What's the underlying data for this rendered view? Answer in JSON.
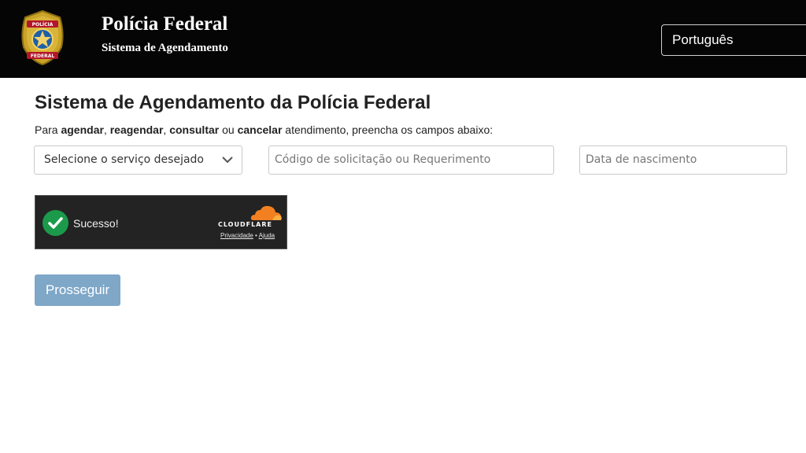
{
  "header": {
    "title": "Polícia Federal",
    "subtitle": "Sistema de Agendamento",
    "badge_text_top": "POLÍCIA",
    "badge_text_bottom": "FEDERAL",
    "language": "Português",
    "background": "#050505"
  },
  "main": {
    "title": "Sistema de Agendamento da Polícia Federal",
    "intro": {
      "prefix": "Para ",
      "w1": "agendar",
      "sep1": ", ",
      "w2": "reagendar",
      "sep2": ", ",
      "w3": "consultar",
      "sep3": " ou ",
      "w4": "cancelar",
      "suffix": " atendimento, preencha os campos abaixo:"
    },
    "service_select": {
      "value": "Selecione o serviço desejado",
      "icon": "chevron-down-icon"
    },
    "code_input": {
      "placeholder": "Código de solicitação ou Requerimento"
    },
    "dob_input": {
      "placeholder": "Data de nascimento"
    },
    "captcha": {
      "status": "Sucesso!",
      "brand": "CLOUDFLARE",
      "privacy": "Privacidade",
      "dot": " • ",
      "help": "Ajuda",
      "success_color": "#1c9a4b",
      "brand_color": "#f38020"
    },
    "submit_label": "Prosseguir",
    "submit_color": "#7ea7c8"
  }
}
